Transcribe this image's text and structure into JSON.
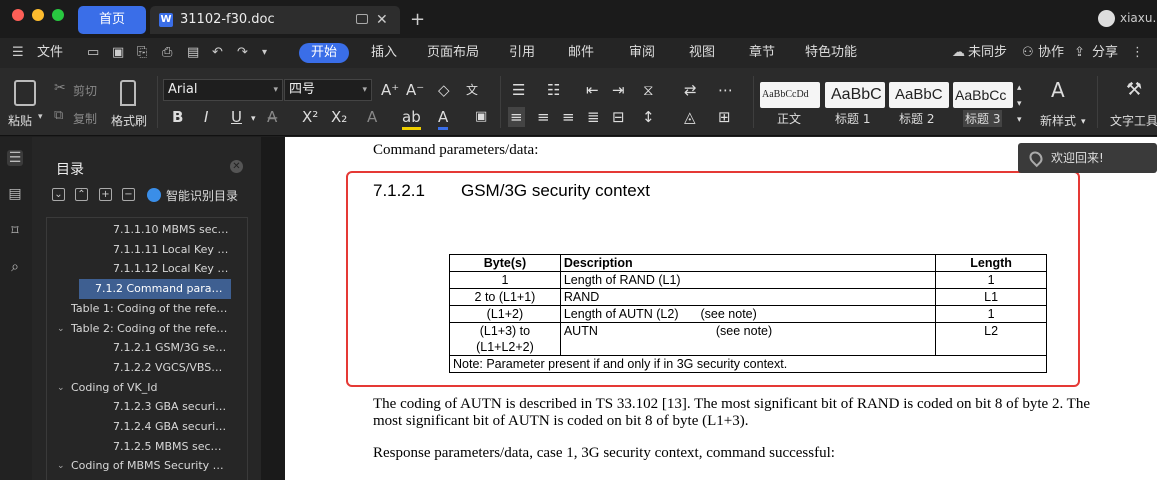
{
  "titlebar": {
    "home_tab": "首页",
    "doc_tab": "31102-f30.doc",
    "doc_icon": "W",
    "new_tab": "+",
    "user_name": "xiaxu."
  },
  "menubar": {
    "items": [
      "文件",
      "开始",
      "插入",
      "页面布局",
      "引用",
      "邮件",
      "审阅",
      "视图",
      "章节",
      "特色功能"
    ],
    "active": "开始",
    "sync": "未同步",
    "collab": "协作",
    "share": "分享"
  },
  "ribbon": {
    "paste": "粘贴",
    "cut": "剪切",
    "copy": "复制",
    "format_painter": "格式刷",
    "font_name": "Arial",
    "font_size": "四号",
    "styles": [
      {
        "preview": "AaBbCcDd",
        "label": "正文"
      },
      {
        "preview": "AaBbC",
        "label": "标题 1"
      },
      {
        "preview": "AaBbC",
        "label": "标题 2"
      },
      {
        "preview": "AaBbCc",
        "label": "标题 3"
      }
    ],
    "new_style": "新样式",
    "text_tools": "文字工具"
  },
  "toc": {
    "title": "目录",
    "smart_label": "智能识别目录",
    "items": [
      {
        "text": "7.1.1.10  MBMS sec…",
        "level": 3,
        "selected": false,
        "chevron": false
      },
      {
        "text": "7.1.1.11  Local Key …",
        "level": 3,
        "selected": false,
        "chevron": false
      },
      {
        "text": "7.1.1.12  Local Key …",
        "level": 3,
        "selected": false,
        "chevron": false
      },
      {
        "text": "7.1.2 Command para…",
        "level": 2,
        "selected": true,
        "chevron": false
      },
      {
        "text": "Table 1: Coding of the refe…",
        "level": 1,
        "selected": false,
        "chevron": false
      },
      {
        "text": "Table 2: Coding of the refe…",
        "level": 1,
        "selected": false,
        "chevron": true
      },
      {
        "text": "7.1.2.1  GSM/3G se…",
        "level": 3,
        "selected": false,
        "chevron": false
      },
      {
        "text": "7.1.2.2  VGCS/VBS…",
        "level": 3,
        "selected": false,
        "chevron": false
      },
      {
        "text": "Coding of VK_Id",
        "level": 1,
        "selected": false,
        "chevron": true
      },
      {
        "text": "7.1.2.3  GBA securi…",
        "level": 3,
        "selected": false,
        "chevron": false
      },
      {
        "text": "7.1.2.4  GBA securi…",
        "level": 3,
        "selected": false,
        "chevron": false
      },
      {
        "text": "7.1.2.5  MBMS sec…",
        "level": 3,
        "selected": false,
        "chevron": false
      },
      {
        "text": "Coding of MBMS Security …",
        "level": 1,
        "selected": false,
        "chevron": true
      }
    ]
  },
  "document": {
    "intro": "Command parameters/data:",
    "heading_num": "7.1.2.1",
    "heading_text": "GSM/3G security context",
    "table": {
      "headers": [
        "Byte(s)",
        "Description",
        "Length"
      ],
      "rows": [
        [
          "1",
          "Length of RAND (L1)",
          "",
          "1"
        ],
        [
          "2 to (L1+1)",
          "RAND",
          "",
          "L1"
        ],
        [
          "(L1+2)",
          "Length of AUTN (L2)",
          "(see note)",
          "1"
        ],
        [
          "(L1+3) to (L1+L2+2)",
          "AUTN",
          "(see note)",
          "L2"
        ]
      ],
      "note": "Note: Parameter present if and only if in 3G security context."
    },
    "para1_line1": "The coding of AUTN is described in TS 33.102 [13]. The most significant bit of RAND is coded on bit 8 of byte 2. The",
    "para1_line2": "most significant bit of AUTN is coded on bit 8 of byte (L1+3).",
    "para2": "Response parameters/data, case 1, 3G security context, command successful:"
  },
  "toast": {
    "text": "欢迎回来!"
  }
}
